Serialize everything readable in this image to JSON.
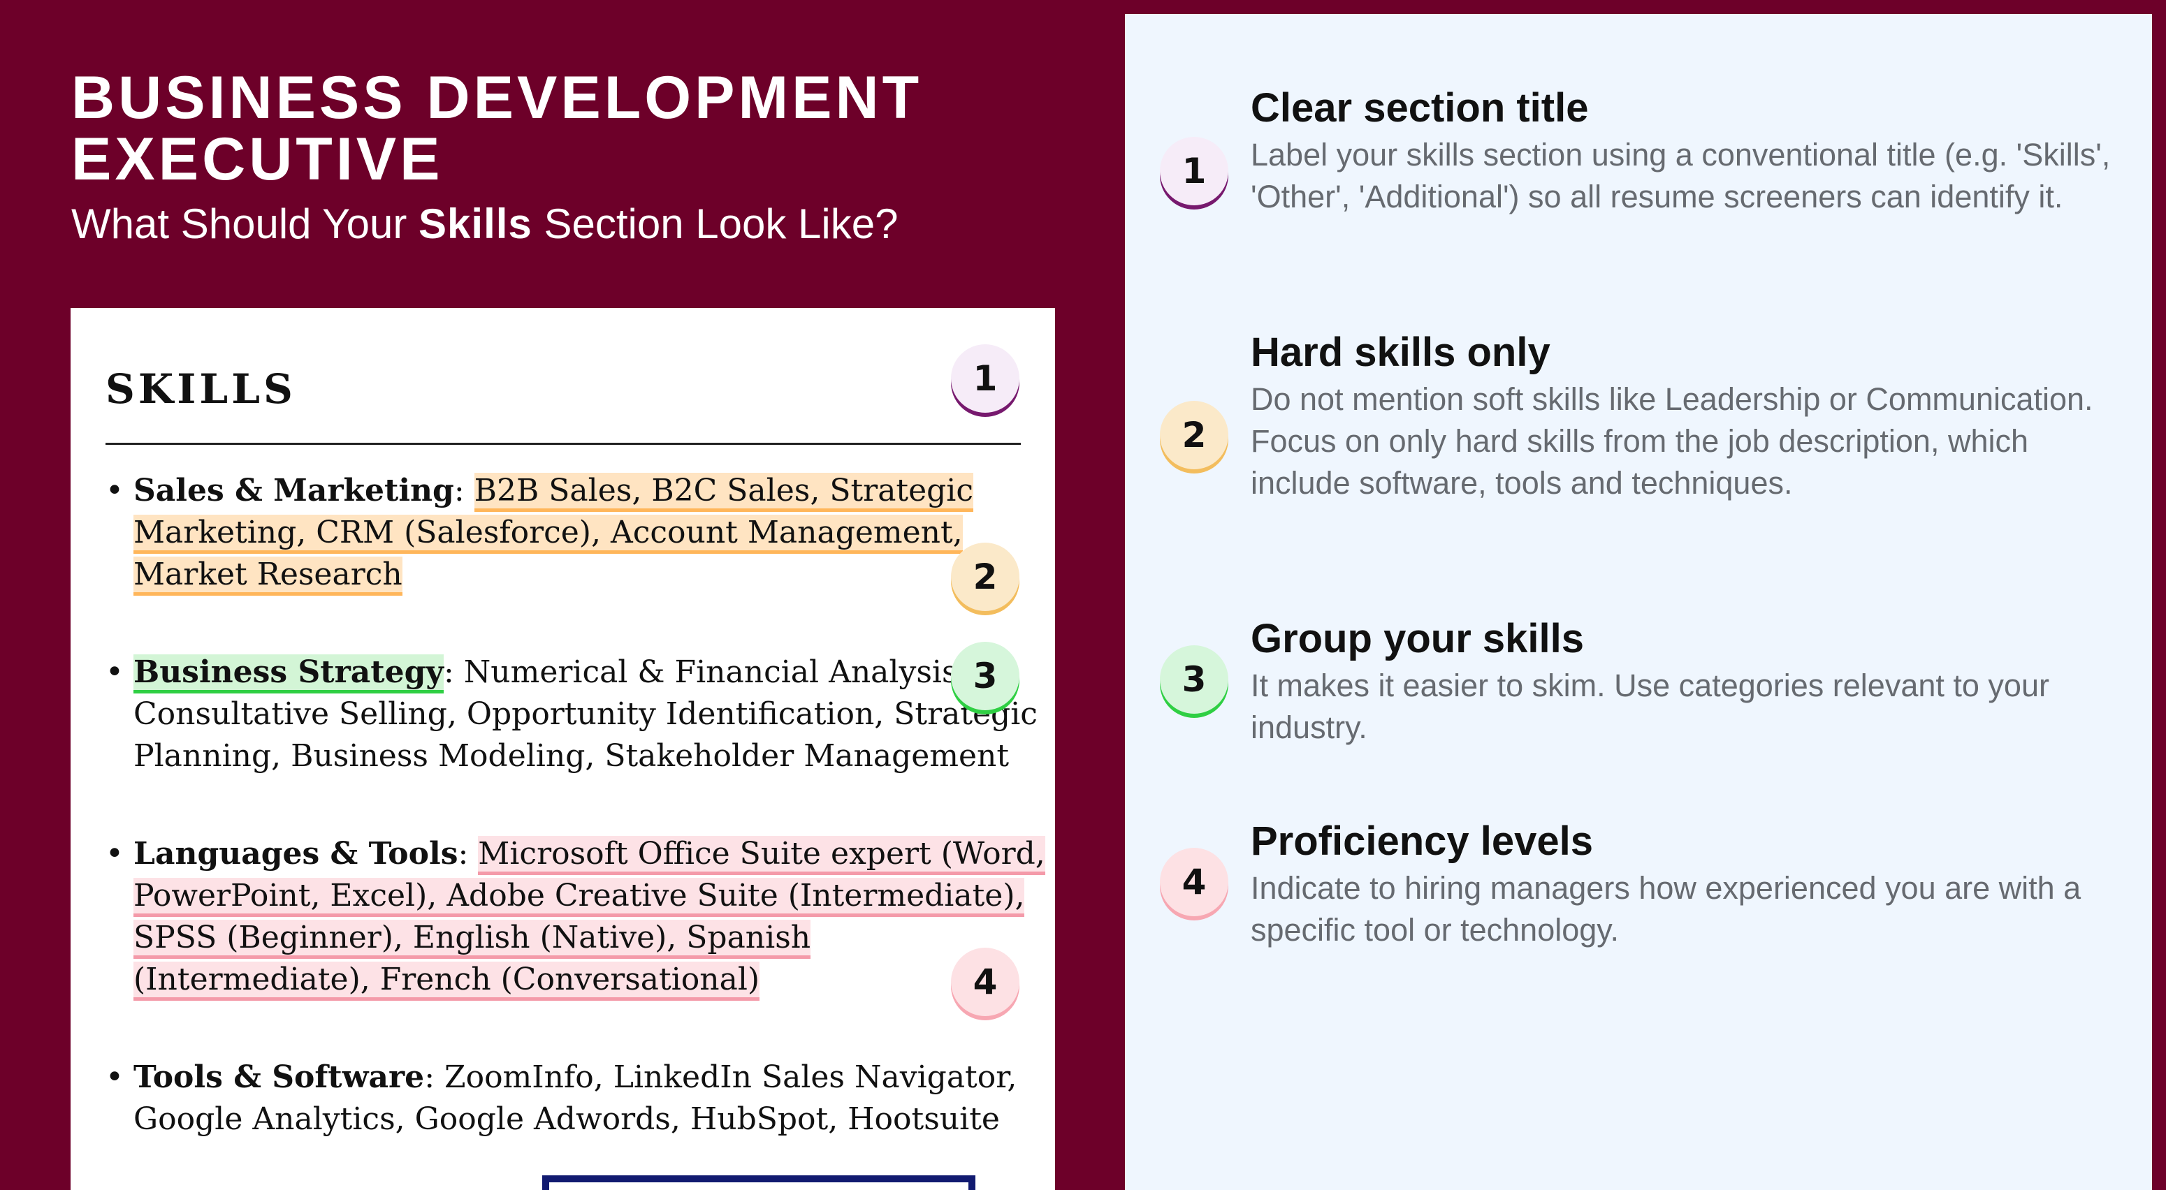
{
  "header": {
    "title": "BUSINESS DEVELOPMENT EXECUTIVE",
    "subtitle_before": "What Should Your ",
    "subtitle_bold": "Skills",
    "subtitle_after": " Section Look Like?"
  },
  "resume": {
    "section_heading": "SKILLS",
    "items": [
      {
        "category": "Sales & Marketing",
        "separator": ": ",
        "skills": "B2B Sales, B2C Sales, Strategic Marketing, CRM (Salesforce), Account Management, Market Research"
      },
      {
        "category": "Business Strategy",
        "separator": ": ",
        "skills": "Numerical & Financial Analysis, Consultative Selling, Opportunity Identification, Strategic Planning, Business Modeling, Stakeholder Management"
      },
      {
        "category": "Languages & Tools",
        "separator": ": ",
        "skills": "Microsoft Office Suite expert (Word, PowerPoint, Excel), Adobe Creative Suite (Intermediate), SPSS (Beginner), English (Native), Spanish (Intermediate), French (Conversational)"
      },
      {
        "category": "Tools & Software",
        "separator": ": ",
        "skills": "ZoomInfo, LinkedIn Sales Navigator, Google Analytics, Google Adwords, HubSpot, Hootsuite"
      }
    ],
    "badges": [
      "1",
      "2",
      "3",
      "4"
    ]
  },
  "tips": [
    {
      "number": "1",
      "title": "Clear section title",
      "description": "Label your skills section using a conventional title (e.g. 'Skills', 'Other', 'Additional') so all resume screeners can identify it."
    },
    {
      "number": "2",
      "title": "Hard skills only",
      "description": "Do not mention soft skills like Leadership or Communication. Focus on only hard skills from the job description, which include software, tools and techniques."
    },
    {
      "number": "3",
      "title": "Group your skills",
      "description": "It makes it easier to skim. Use categories relevant to your industry."
    },
    {
      "number": "4",
      "title": "Proficiency levels",
      "description": "Indicate to hiring managers how experienced you are with a specific tool or technology."
    }
  ],
  "colors": {
    "background": "#6d0029",
    "panel": "#eff6fe",
    "badge1": "#77196e",
    "badge2": "#f3bd5d",
    "badge3": "#2fcf43",
    "badge4": "#f7a7b2"
  }
}
